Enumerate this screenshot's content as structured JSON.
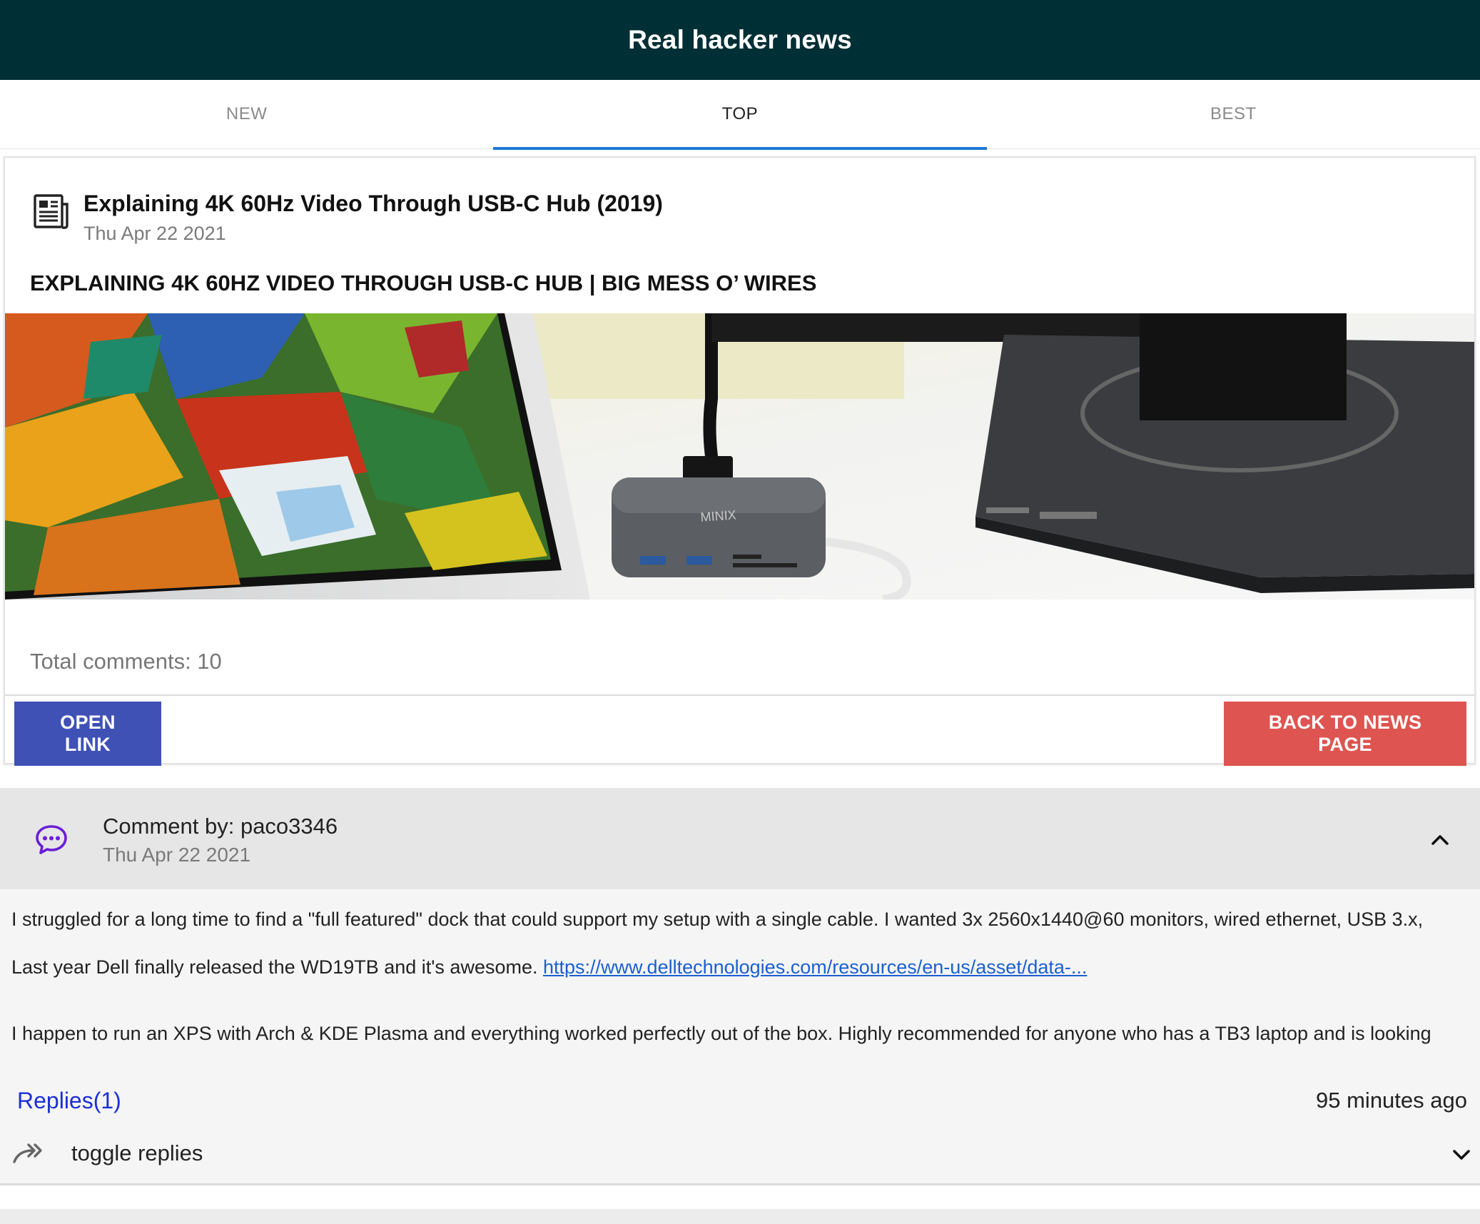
{
  "app": {
    "title": "Real hacker news"
  },
  "tabs": [
    {
      "label": "NEW"
    },
    {
      "label": "TOP"
    },
    {
      "label": "BEST"
    }
  ],
  "story": {
    "icon": "newspaper-icon",
    "title": "Explaining 4K 60Hz Video Through USB-C Hub (2019)",
    "date": "Thu Apr 22 2021",
    "link_title": "EXPLAINING 4K 60HZ VIDEO THROUGH USB-C HUB | BIG MESS O’ WIRES",
    "total_comments": "Total comments: 10",
    "open_link_label": "OPEN LINK",
    "back_label": "BACK TO NEWS PAGE"
  },
  "comment": {
    "icon": "chat-bubble-icon",
    "by": "Comment by: paco3346",
    "date": "Thu Apr 22 2021",
    "line1": "I struggled for a long time to find a \"full featured\" dock that could support my setup with a single cable. I wanted 3x 2560x1440@60 monitors, wired ethernet, USB 3.x,",
    "line2_text": "Last year Dell finally released the WD19TB and it's awesome. ",
    "line2_link": "https://www.delltechnologies.com/resources/en-us/asset/data-...",
    "line3": "I happen to run an XPS with Arch & KDE Plasma and everything worked perfectly out of the box. Highly recommended for anyone who has a TB3 laptop and is looking",
    "replies": "Replies(1)",
    "time_ago": "95 minutes ago",
    "toggle": "toggle replies"
  },
  "colors": {
    "appbar": "#002f35",
    "tab_indicator": "#1e79d6",
    "open_button": "#3f51b5",
    "back_button": "#de5450",
    "chat_icon": "#6a1fd6",
    "link": "#1a5fd1",
    "replies": "#1b2fd6"
  }
}
